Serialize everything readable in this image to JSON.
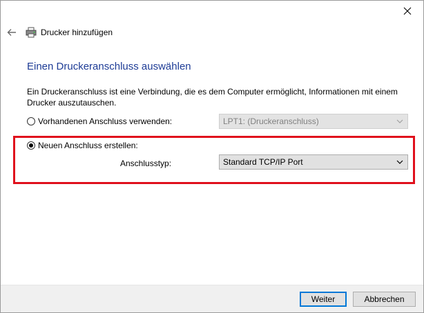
{
  "window": {
    "title": "Drucker hinzufügen",
    "close_label": "close",
    "back_label": "back"
  },
  "content": {
    "heading": "Einen Druckeranschluss auswählen",
    "description": "Ein Druckeranschluss ist eine Verbindung, die es dem Computer ermöglicht, Informationen mit einem Drucker auszutauschen.",
    "existing_port": {
      "label": "Vorhandenen Anschluss verwenden:",
      "selected": false,
      "select_value": "LPT1: (Druckeranschluss)",
      "enabled": false
    },
    "new_port": {
      "label": "Neuen Anschluss erstellen:",
      "selected": true,
      "type_label": "Anschlusstyp:",
      "select_value": "Standard TCP/IP Port",
      "enabled": true
    }
  },
  "footer": {
    "next_label": "Weiter",
    "cancel_label": "Abbrechen"
  },
  "colors": {
    "heading": "#1e3c96",
    "highlight_border": "#e0101c",
    "primary_button_border": "#0078d7"
  },
  "icons": {
    "back": "back-arrow-icon",
    "printer": "printer-icon",
    "close": "close-icon",
    "chevron": "chevron-down-icon"
  }
}
